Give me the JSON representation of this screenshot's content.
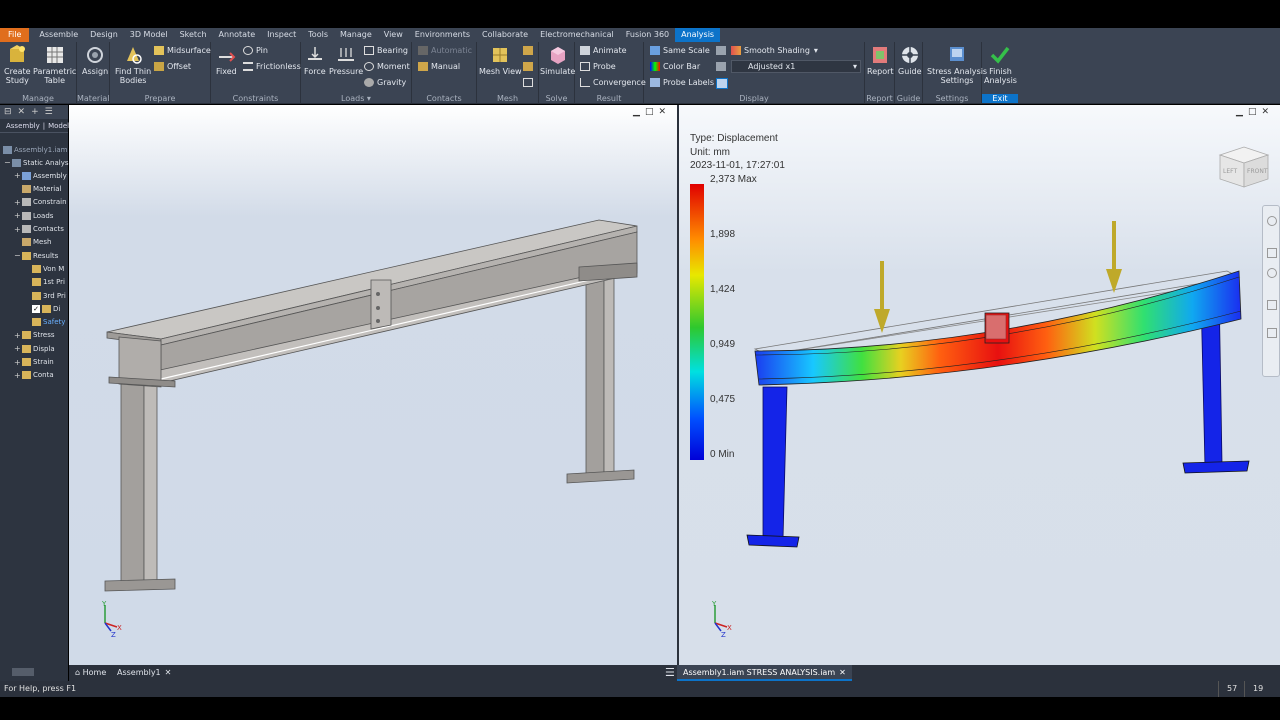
{
  "menu": {
    "tabs": [
      "File",
      "Assemble",
      "Design",
      "3D Model",
      "Sketch",
      "Annotate",
      "Inspect",
      "Tools",
      "Manage",
      "View",
      "Environments",
      "Collaborate",
      "Electromechanical",
      "Fusion 360",
      "Analysis"
    ],
    "active": "Analysis"
  },
  "ribbon": {
    "manage": {
      "label": "Manage",
      "create_study": "Create\nStudy",
      "parametric_table": "Parametric\nTable"
    },
    "material": {
      "label": "Material",
      "assign": "Assign"
    },
    "prepare": {
      "label": "Prepare",
      "find_thin_bodies": "Find Thin\nBodies",
      "midsurface": "Midsurface",
      "offset": "Offset"
    },
    "constraints": {
      "label": "Constraints",
      "fixed": "Fixed",
      "pin": "Pin",
      "frictionless": "Frictionless"
    },
    "loads": {
      "label": "Loads",
      "force": "Force",
      "pressure": "Pressure",
      "bearing": "Bearing",
      "moment": "Moment",
      "gravity": "Gravity"
    },
    "contacts": {
      "label": "Contacts",
      "automatic": "Automatic",
      "manual": "Manual"
    },
    "mesh": {
      "label": "Mesh",
      "mesh_view": "Mesh View"
    },
    "solve": {
      "label": "Solve",
      "simulate": "Simulate"
    },
    "result": {
      "label": "Result",
      "animate": "Animate",
      "probe": "Probe",
      "convergence": "Convergence"
    },
    "display": {
      "label": "Display",
      "same_scale": "Same Scale",
      "color_bar": "Color Bar",
      "probe_labels": "Probe Labels",
      "smooth_shading": "Smooth Shading",
      "adjusted": "Adjusted x1"
    },
    "report": {
      "label": "Report",
      "report": "Report"
    },
    "guide": {
      "label": "Guide",
      "guide": "Guide"
    },
    "settings": {
      "label": "Settings",
      "stress_analysis_settings": "Stress Analysis\nSettings"
    },
    "exit": {
      "label": "Exit",
      "finish_analysis": "Finish\nAnalysis"
    }
  },
  "browser": {
    "tabs": [
      "Assembly",
      "Modelin"
    ],
    "root": "Assembly1.iam S",
    "items": [
      {
        "label": "Static Analysi",
        "indent": 0,
        "pm": "−"
      },
      {
        "label": "Assembly",
        "indent": 1,
        "pm": "+"
      },
      {
        "label": "Material",
        "indent": 1,
        "pm": ""
      },
      {
        "label": "Constrain",
        "indent": 1,
        "pm": "+"
      },
      {
        "label": "Loads",
        "indent": 1,
        "pm": "+"
      },
      {
        "label": "Contacts",
        "indent": 1,
        "pm": "+"
      },
      {
        "label": "Mesh",
        "indent": 1,
        "pm": ""
      },
      {
        "label": "Results",
        "indent": 1,
        "pm": "−"
      },
      {
        "label": "Von M",
        "indent": 2,
        "pm": ""
      },
      {
        "label": "1st Pri",
        "indent": 2,
        "pm": ""
      },
      {
        "label": "3rd Pri",
        "indent": 2,
        "pm": ""
      },
      {
        "label": "Di",
        "indent": 2,
        "pm": "✓"
      },
      {
        "label": "Safety",
        "indent": 2,
        "pm": ""
      },
      {
        "label": "Stress",
        "indent": 1,
        "pm": "+"
      },
      {
        "label": "Displa",
        "indent": 1,
        "pm": "+"
      },
      {
        "label": "Strain",
        "indent": 1,
        "pm": "+"
      },
      {
        "label": "Conta",
        "indent": 1,
        "pm": "+"
      }
    ]
  },
  "result": {
    "type": "Type: Displacement",
    "unit": "Unit: mm",
    "timestamp": "2023-11-01, 17:27:01",
    "legend": [
      "2,373 Max",
      "1,898",
      "1,424",
      "0,949",
      "0,475",
      "0 Min"
    ]
  },
  "viewcube": {
    "left": "LEFT",
    "front": "FRONT"
  },
  "tabs": {
    "home": "Home",
    "doc1": "Assembly1",
    "doc2": "Assembly1.iam STRESS ANALYSIS.iam"
  },
  "status": {
    "help": "For Help, press F1",
    "count1": "57",
    "count2": "19"
  },
  "triad": {
    "x": "X",
    "y": "Y",
    "z": "Z"
  }
}
